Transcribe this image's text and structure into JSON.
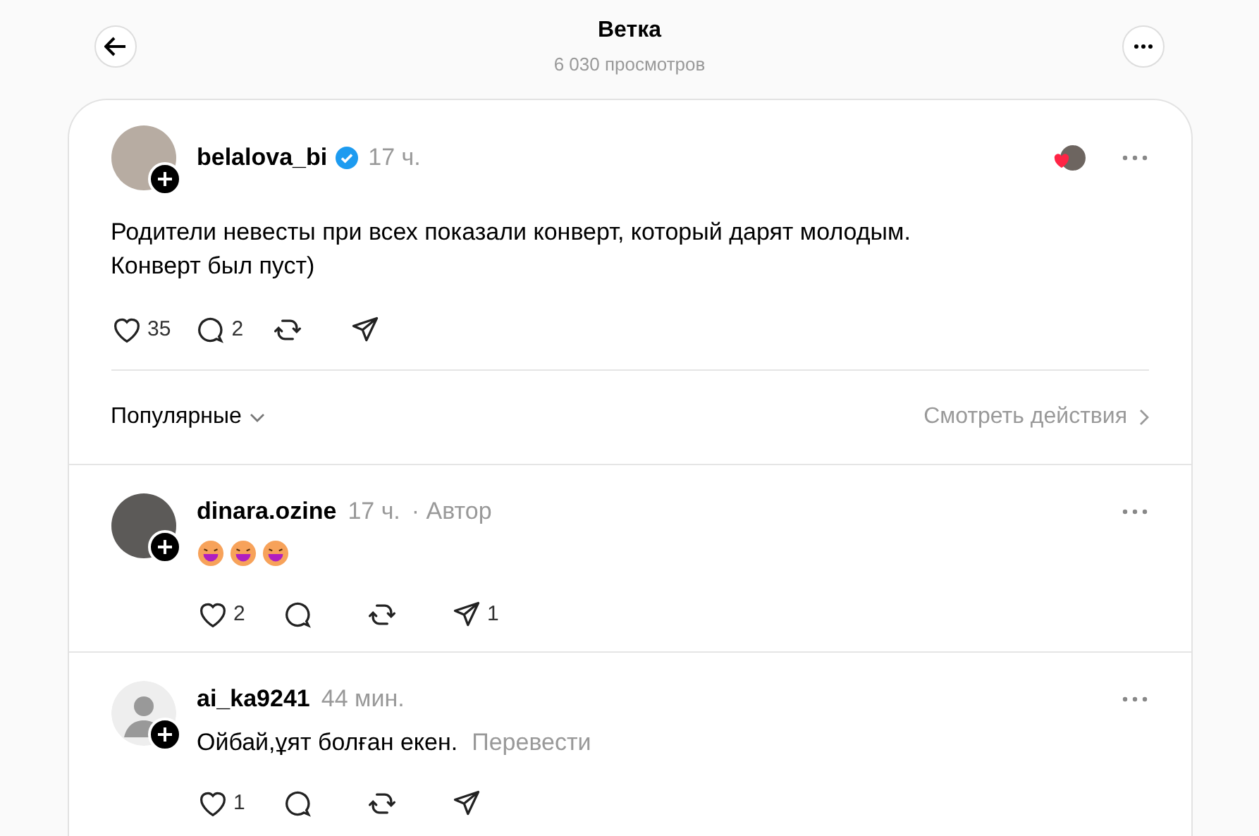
{
  "header": {
    "title": "Ветка",
    "subtitle": "6 030 просмотров"
  },
  "post": {
    "username": "belalova_bi",
    "verified": true,
    "time": "17 ч.",
    "text": "Родители невесты при всех показали конверт, который дарят молодым.\nКонверт был пуст)",
    "likes": "35",
    "replies": "2"
  },
  "sort": {
    "label": "Популярные",
    "activity_link": "Смотреть действия"
  },
  "comments": [
    {
      "username": "dinara.ozine",
      "time": "17 ч.",
      "author_tag": "· Автор",
      "kind": "photo",
      "likes": "2",
      "shares": "1"
    },
    {
      "username": "ai_ka9241",
      "time": "44 мин.",
      "kind": "default",
      "text": "Ойбай,ұят болған екен.",
      "translate": "Перевести",
      "likes": "1"
    }
  ]
}
